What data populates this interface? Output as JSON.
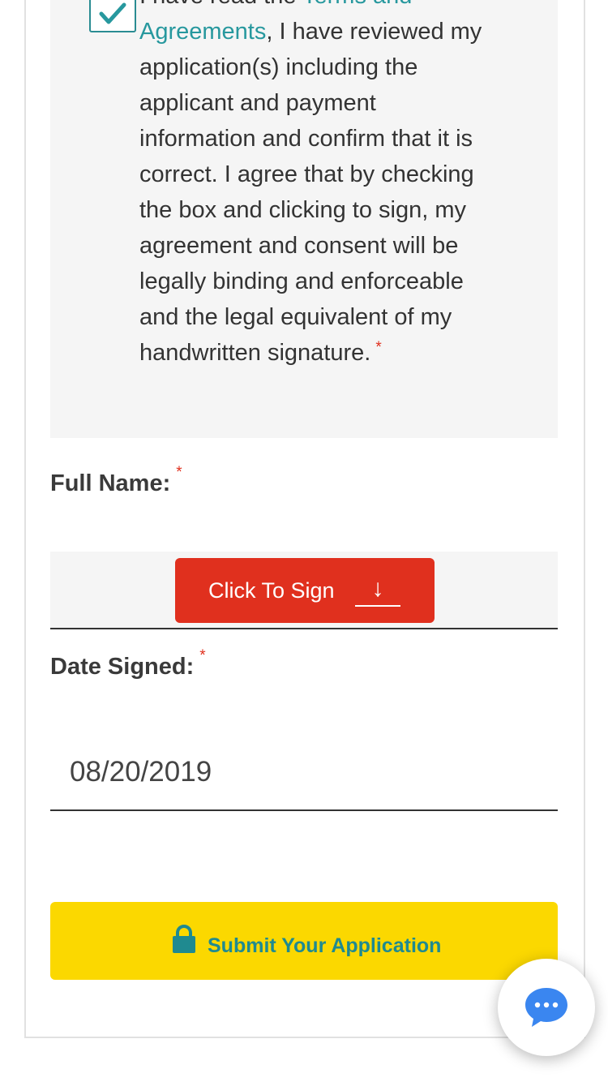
{
  "agreement": {
    "checked": true,
    "text_before": "I have read the ",
    "link_text": "Terms and Agreements",
    "text_after": ", I have reviewed my application(s) including the applicant and payment information and confirm that it is correct. I agree that by checking the box and clicking to sign, my agreement and consent will be legally binding and enforceable and the legal equivalent of my handwritten signature.",
    "required_mark": "*"
  },
  "full_name": {
    "label": "Full Name:",
    "required_mark": "*",
    "sign_button_label": "Click To Sign",
    "sign_button_arrow": "↓"
  },
  "date_signed": {
    "label": "Date Signed:",
    "required_mark": "*",
    "value": "08/20/2019"
  },
  "submit": {
    "label": "Submit Your Application",
    "icon": "lock-icon"
  },
  "chat": {
    "icon": "chat-bubble-icon"
  },
  "colors": {
    "accent_teal": "#27989e",
    "sign_red": "#e0301e",
    "submit_yellow": "#fbd800",
    "chat_blue": "#3a86f0"
  }
}
